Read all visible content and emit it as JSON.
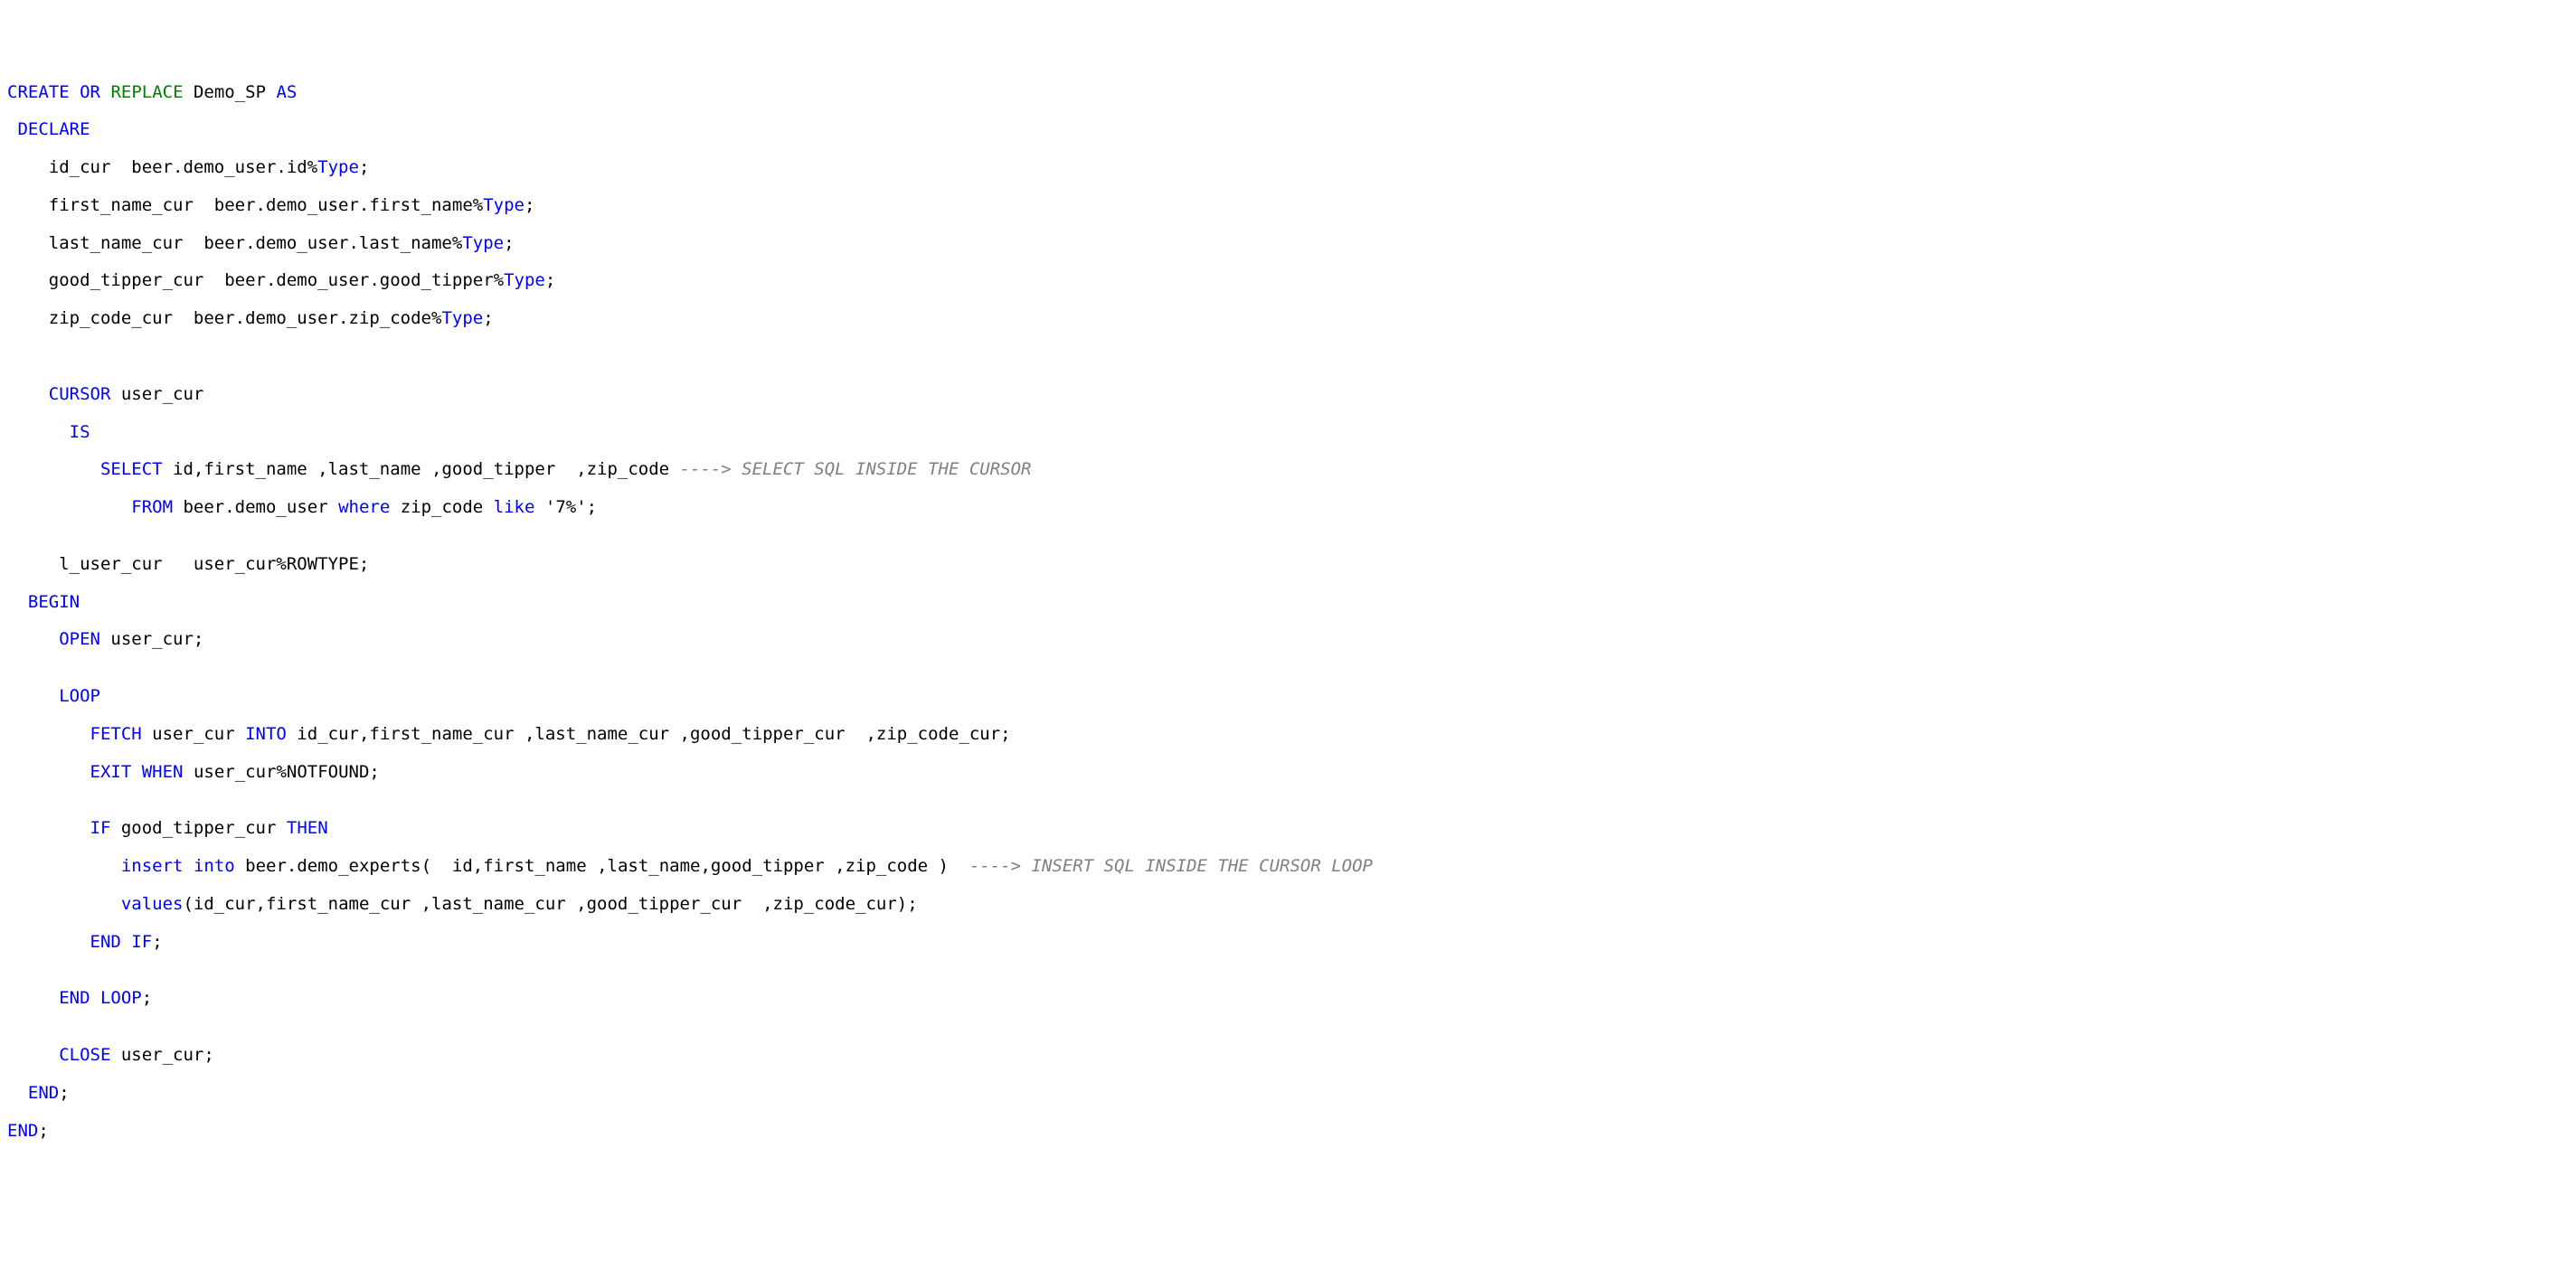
{
  "colors": {
    "keyword_blue": "#0000ff",
    "keyword_green": "#008000",
    "comment_gray": "#808080",
    "text_black": "#000000",
    "background": "#ffffff"
  },
  "code": {
    "t01a": "CREATE",
    "t01b": " ",
    "t01c": "OR",
    "t01d": " ",
    "t01e": "REPLACE",
    "t01f": " Demo_SP ",
    "t01g": "AS",
    "t02a": " ",
    "t02b": "DECLARE",
    "t03a": "    id_cur  beer.demo_user.id%",
    "t03b": "Type",
    "t03c": ";",
    "t04a": "    first_name_cur  beer.demo_user.first_name%",
    "t04b": "Type",
    "t04c": ";",
    "t05a": "    last_name_cur  beer.demo_user.last_name%",
    "t05b": "Type",
    "t05c": ";",
    "t06a": "    good_tipper_cur  beer.demo_user.good_tipper%",
    "t06b": "Type",
    "t06c": ";",
    "t07a": "    zip_code_cur  beer.demo_user.zip_code%",
    "t07b": "Type",
    "t07c": ";",
    "t08": "",
    "t09": "",
    "t10a": "    ",
    "t10b": "CURSOR",
    "t10c": " user_cur",
    "t11a": "      ",
    "t11b": "IS",
    "t12a": "         ",
    "t12b": "SELECT",
    "t12c": " id,first_name ,last_name ,good_tipper  ,zip_code ",
    "t12d": "----> SELECT SQL INSIDE THE CURSOR",
    "t13a": "            ",
    "t13b": "FROM",
    "t13c": " beer.demo_user ",
    "t13d": "where",
    "t13e": " zip_code ",
    "t13f": "like",
    "t13g": " '7%';",
    "t14": "",
    "t15a": "     l_user_cur   user_cur%ROWTYPE;",
    "t16a": "  ",
    "t16b": "BEGIN",
    "t17a": "     ",
    "t17b": "OPEN",
    "t17c": " user_cur;",
    "t18": "",
    "t19a": "     ",
    "t19b": "LOOP",
    "t20a": "        ",
    "t20b": "FETCH",
    "t20c": " user_cur ",
    "t20d": "INTO",
    "t20e": " id_cur,first_name_cur ,last_name_cur ,good_tipper_cur  ,zip_code_cur;",
    "t21a": "        ",
    "t21b": "EXIT",
    "t21c": " ",
    "t21d": "WHEN",
    "t21e": " user_cur%NOTFOUND;",
    "t22": "",
    "t23a": "        ",
    "t23b": "IF",
    "t23c": " good_tipper_cur ",
    "t23d": "THEN",
    "t23e": "",
    "t24a": "           ",
    "t24b": "insert",
    "t24c": " ",
    "t24d": "into",
    "t24e": " beer.demo_experts(  id,first_name ,last_name,good_tipper ,zip_code )  ",
    "t24f": "----> INSERT SQL INSIDE THE CURSOR LOOP",
    "t25a": "           ",
    "t25b": "values",
    "t25c": "(id_cur,first_name_cur ,last_name_cur ,good_tipper_cur  ,zip_code_cur);",
    "t26a": "        ",
    "t26b": "END",
    "t26c": " ",
    "t26d": "IF",
    "t26e": ";",
    "t27": "",
    "t28a": "     ",
    "t28b": "END",
    "t28c": " ",
    "t28d": "LOOP",
    "t28e": ";",
    "t29": "",
    "t30a": "     ",
    "t30b": "CLOSE",
    "t30c": " user_cur;",
    "t31a": "  ",
    "t31b": "END",
    "t31c": ";",
    "t32a": "END",
    "t32b": ";"
  }
}
